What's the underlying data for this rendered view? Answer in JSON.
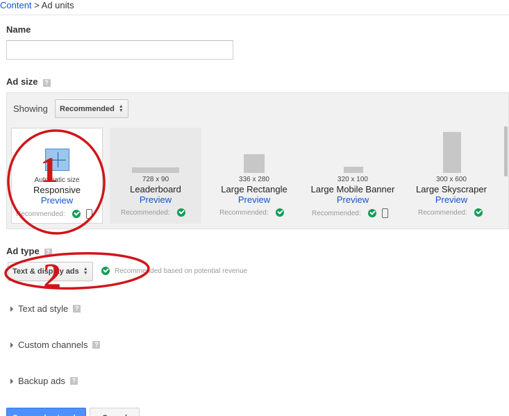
{
  "breadcrumb": {
    "parent": "Content",
    "separator": " > ",
    "current": "Ad units"
  },
  "name_section": {
    "label": "Name",
    "input_value": "",
    "input_placeholder": ""
  },
  "ad_size": {
    "label": "Ad size",
    "help": "?",
    "showing_label": "Showing",
    "showing_value": "Recommended",
    "tiles": [
      {
        "dims": "Automatic size",
        "name": "Responsive",
        "preview": "Preview",
        "recommended": "Recommended:"
      },
      {
        "dims": "728 x 90",
        "name": "Leaderboard",
        "preview": "Preview",
        "recommended": "Recommended:"
      },
      {
        "dims": "336 x 280",
        "name": "Large Rectangle",
        "preview": "Preview",
        "recommended": "Recommended:"
      },
      {
        "dims": "320 x 100",
        "name": "Large Mobile Banner",
        "preview": "Preview",
        "recommended": "Recommended:"
      },
      {
        "dims": "300 x 600",
        "name": "Large Skyscraper",
        "preview": "Preview",
        "recommended": "Recommended:"
      }
    ]
  },
  "ad_type": {
    "label": "Ad type",
    "help": "?",
    "select_value": "Text & display ads",
    "recommendation": "Recommended based on potential revenue"
  },
  "collapsibles": [
    {
      "label": "Text ad style",
      "help": "?"
    },
    {
      "label": "Custom channels",
      "help": "?"
    },
    {
      "label": "Backup ads",
      "help": "?"
    }
  ],
  "actions": {
    "save_label": "Save and get code",
    "cancel_label": "Cancel"
  },
  "annotations": {
    "marker_1": "1",
    "marker_2": "2",
    "color": "#d0151a"
  },
  "colors": {
    "link": "#1155cc",
    "check": "#0f9d58",
    "primary_button": "#4d90fe",
    "responsive_icon": "#9cc6ee"
  }
}
